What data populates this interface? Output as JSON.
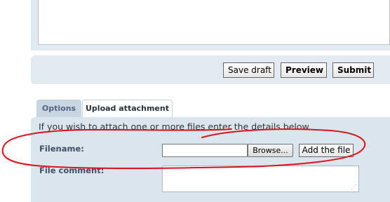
{
  "submit_bar": {
    "save_draft_label": "Save draft",
    "preview_label": "Preview",
    "submit_label": "Submit"
  },
  "tabs": [
    {
      "label": "Options",
      "active": false
    },
    {
      "label": "Upload attachment",
      "active": true
    }
  ],
  "upload": {
    "intro": "If you wish to attach one or more files enter the details below.",
    "filename_label": "Filename:",
    "filename_value": "",
    "browse_label": "Browse...",
    "add_file_label": "Add the file",
    "comment_label": "File comment:",
    "comment_value": ""
  },
  "colors": {
    "panel_bg": "#dbe5ee",
    "annotation_stroke": "#e0101a"
  }
}
